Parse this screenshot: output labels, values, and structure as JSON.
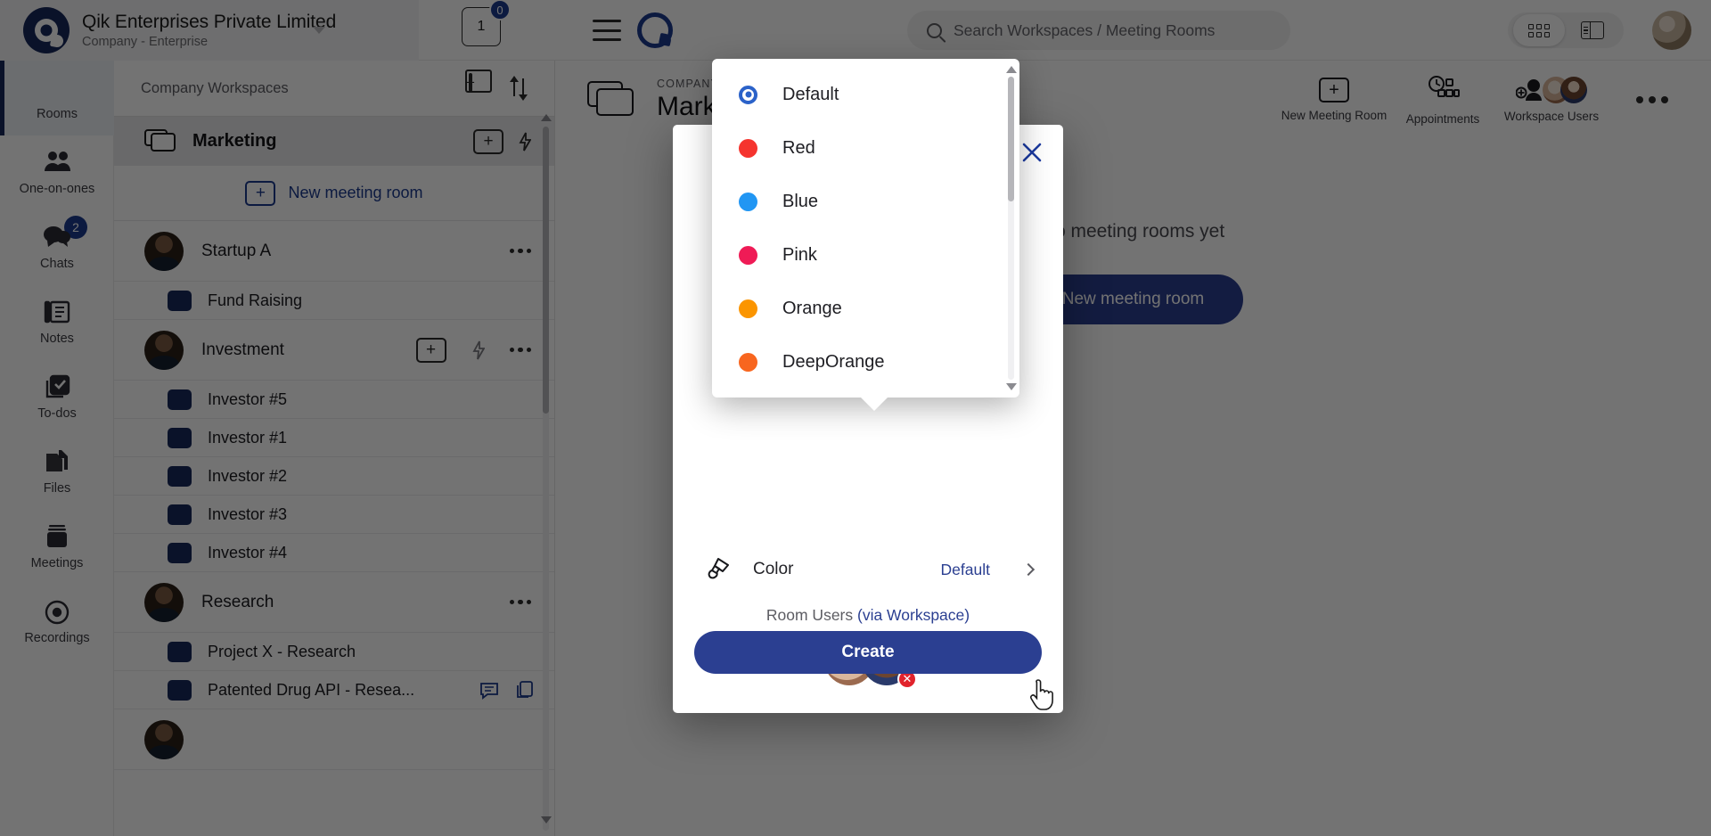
{
  "topbar": {
    "org_name": "Qik Enterprises Private Limited",
    "org_subtitle": "Company - Enterprise",
    "workspace_count": "1",
    "notification_badge": "0",
    "search_placeholder": "Search Workspaces / Meeting Rooms"
  },
  "rail": {
    "items": [
      {
        "label": "Rooms",
        "icon": "rooms-icon",
        "badge": "",
        "selected": true
      },
      {
        "label": "One-on-ones",
        "icon": "people-icon",
        "badge": "",
        "selected": false
      },
      {
        "label": "Chats",
        "icon": "chat-bubble-icon",
        "badge": "2",
        "selected": false
      },
      {
        "label": "Notes",
        "icon": "notes-icon",
        "badge": "",
        "selected": false
      },
      {
        "label": "To-dos",
        "icon": "checkbox-icon",
        "badge": "",
        "selected": false
      },
      {
        "label": "Files",
        "icon": "files-icon",
        "badge": "",
        "selected": false
      },
      {
        "label": "Meetings",
        "icon": "meetings-icon",
        "badge": "",
        "selected": false
      },
      {
        "label": "Recordings",
        "icon": "recordings-icon",
        "badge": "",
        "selected": false
      }
    ]
  },
  "workspace_panel": {
    "header_title": "Company Workspaces",
    "add_workspace_icon": "add-workspace-icon",
    "sort_icon": "sort-icon",
    "group": {
      "name": "Marketing",
      "folder_icon": "folder-icon",
      "add_icon": "plus-box-icon",
      "bolt_icon": "bolt-icon"
    },
    "new_meeting_room_label": "New meeting room",
    "sections": [
      {
        "name": "Startup A",
        "has_add": false,
        "rooms": [
          {
            "name": "Fund Raising",
            "icons": []
          }
        ]
      },
      {
        "name": "Investment",
        "has_add": true,
        "rooms": [
          {
            "name": "Investor #5",
            "icons": []
          },
          {
            "name": "Investor #1",
            "icons": []
          },
          {
            "name": "Investor #2",
            "icons": []
          },
          {
            "name": "Investor #3",
            "icons": []
          },
          {
            "name": "Investor #4",
            "icons": []
          }
        ]
      },
      {
        "name": "Research",
        "has_add": false,
        "rooms": [
          {
            "name": "Project X - Research",
            "icons": []
          },
          {
            "name": "Patented Drug API - Resea...",
            "icons": [
              "chat-icon",
              "copy-icon"
            ]
          }
        ]
      }
    ]
  },
  "main": {
    "kicker": "COMPANY WORKSPACE",
    "title": "Marketing",
    "actions": [
      {
        "label": "New Meeting Room",
        "icon": "plus-box-icon"
      },
      {
        "label": "Appointments",
        "icon": "appointments-icon"
      },
      {
        "label": "Workspace Users",
        "icon": "workspace-users-icon"
      }
    ],
    "more_icon": "more-dots-icon",
    "empty_text": "No meeting rooms yet",
    "empty_button": "New meeting room"
  },
  "modal": {
    "close_icon": "close-icon",
    "color_row": {
      "icon": "paint-brush-icon",
      "label": "Color",
      "value": "Default",
      "chevron": "chevron-right-icon"
    },
    "room_users_label": "Room Users ",
    "room_users_link": "(via Workspace)",
    "user_avatars": [
      {
        "name": "user-avatar-1",
        "removable": false
      },
      {
        "name": "user-avatar-2",
        "removable": true
      }
    ],
    "remove_icon": "remove-user-icon",
    "create_button": "Create"
  },
  "color_dropdown": {
    "options": [
      {
        "label": "Default",
        "color": "#2b62c9",
        "selected": true
      },
      {
        "label": "Red",
        "color": "#f5342e",
        "selected": false
      },
      {
        "label": "Blue",
        "color": "#2196f3",
        "selected": false
      },
      {
        "label": "Pink",
        "color": "#ef1b56",
        "selected": false
      },
      {
        "label": "Orange",
        "color": "#fb9500",
        "selected": false
      },
      {
        "label": "DeepOrange",
        "color": "#f8661f",
        "selected": false
      }
    ]
  },
  "theme": {
    "accent": "#2b3f91",
    "brand_dark": "#17285c",
    "link": "#1b3a8f"
  }
}
